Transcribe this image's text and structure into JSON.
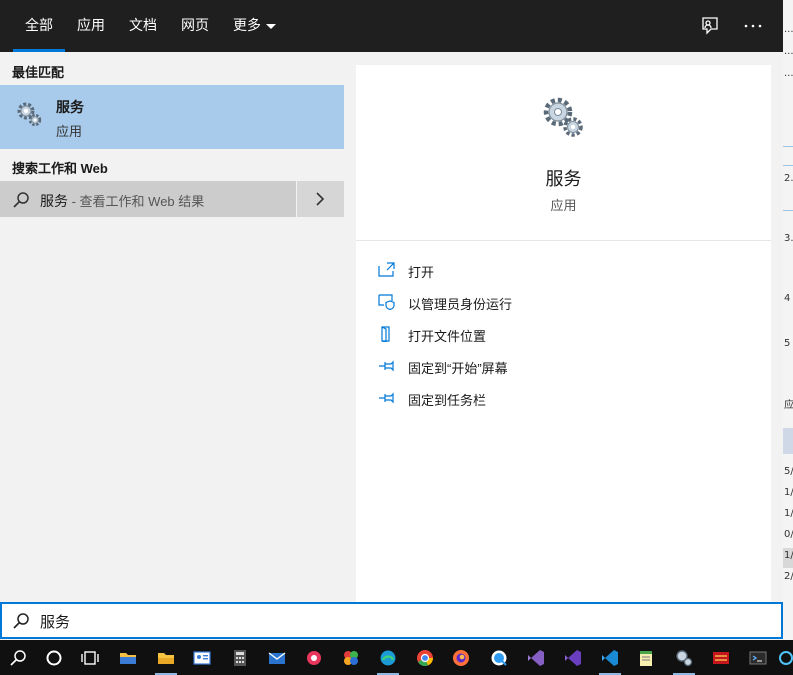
{
  "tabs": [
    {
      "label": "全部",
      "active": true
    },
    {
      "label": "应用",
      "active": false
    },
    {
      "label": "文档",
      "active": false
    },
    {
      "label": "网页",
      "active": false
    },
    {
      "label": "更多",
      "active": false
    }
  ],
  "toolbar": {
    "feedback_icon": "feedback-icon",
    "more_icon": "ellipsis-icon"
  },
  "best_match": {
    "section_title": "最佳匹配",
    "name": "服务",
    "type": "应用",
    "icon": "services-gear-icon"
  },
  "web": {
    "section_title": "搜索工作和 Web",
    "query": "服务",
    "suffix": " - 查看工作和 Web 结果",
    "icon": "search-icon",
    "arrow_icon": "chevron-right-icon"
  },
  "preview": {
    "name": "服务",
    "type": "应用",
    "actions": [
      {
        "label": "打开",
        "icon": "open-icon"
      },
      {
        "label": "以管理员身份运行",
        "icon": "shield-admin-icon"
      },
      {
        "label": "打开文件位置",
        "icon": "file-location-icon"
      },
      {
        "label": "固定到“开始”屏幕",
        "icon": "pin-icon"
      },
      {
        "label": "固定到任务栏",
        "icon": "pin-icon"
      }
    ]
  },
  "search": {
    "value": "服务",
    "icon": "search-icon"
  },
  "background_window": {
    "fragments": [
      "...",
      "2.",
      "3.",
      "4",
      "5",
      "应",
      "5/",
      "1/",
      "1/",
      "0/",
      "1/",
      "2/"
    ]
  },
  "colors": {
    "accent": "#0078d7",
    "selected": "#a9cbeb",
    "tabbar": "#1f1f1f",
    "taskbar": "#101010"
  },
  "taskbar": [
    "search-icon",
    "cortana-icon",
    "task-view-icon",
    "file-explorer-icon",
    "folder-icon",
    "contacts-icon",
    "calculator-icon",
    "mail-icon",
    "media-player-icon",
    "puzzle-app-icon",
    "edge-icon",
    "chrome-icon",
    "firefox-icon",
    "qq-browser-icon",
    "visual-studio-icon",
    "visual-studio-preview-icon",
    "vscode-icon",
    "notepad-icon",
    "services-icon",
    "red-app-icon",
    "terminal-icon",
    "network-app-icon"
  ]
}
